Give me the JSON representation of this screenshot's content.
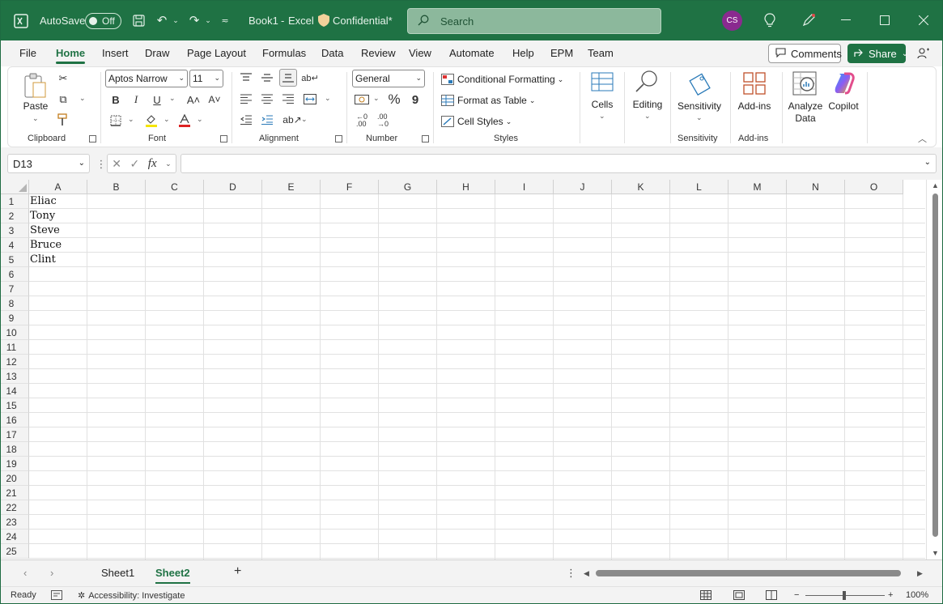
{
  "titlebar": {
    "autosave_label": "AutoSave",
    "autosave_state": "Off",
    "doc_name": "Book1",
    "app_name": "Excel",
    "separator": "-",
    "sensitivity": "Confidential*",
    "search_placeholder": "Search",
    "avatar_initials": "CS"
  },
  "menu": {
    "tabs": [
      "File",
      "Home",
      "Insert",
      "Draw",
      "Page Layout",
      "Formulas",
      "Data",
      "Review",
      "View",
      "Automate",
      "Help",
      "EPM",
      "Team"
    ],
    "active": "Home",
    "comments": "Comments",
    "share": "Share"
  },
  "ribbon": {
    "clipboard": {
      "label": "Clipboard",
      "paste": "Paste"
    },
    "font": {
      "label": "Font",
      "family": "Aptos Narrow",
      "size": "11",
      "bold": "B",
      "italic": "I",
      "underline": "U",
      "grow": "A˄",
      "shrink": "A˅"
    },
    "alignment": {
      "label": "Alignment"
    },
    "number": {
      "label": "Number",
      "format": "General",
      "percent": "%",
      "comma": "9"
    },
    "styles": {
      "label": "Styles",
      "conditional": "Conditional Formatting",
      "format_table": "Format as Table",
      "cell_styles": "Cell Styles"
    },
    "cells": {
      "label": "Cells"
    },
    "editing": {
      "label": "Editing"
    },
    "sensitivity": {
      "button": "Sensitivity",
      "label": "Sensitivity"
    },
    "addins": {
      "button": "Add-ins",
      "label": "Add-ins"
    },
    "analyze": {
      "line1": "Analyze",
      "line2": "Data"
    },
    "copilot": "Copilot"
  },
  "formula_bar": {
    "name_box": "D13",
    "fx": "fx",
    "value": ""
  },
  "columns": [
    "A",
    "B",
    "C",
    "D",
    "E",
    "F",
    "G",
    "H",
    "I",
    "J",
    "K",
    "L",
    "M",
    "N",
    "O"
  ],
  "rows": [
    "1",
    "2",
    "3",
    "4",
    "5",
    "6",
    "7",
    "8",
    "9",
    "10",
    "11",
    "12",
    "13",
    "14",
    "15",
    "16",
    "17",
    "18",
    "19",
    "20",
    "21",
    "22",
    "23",
    "24",
    "25"
  ],
  "cells_A": [
    "Eliac",
    "Tony",
    "Steve",
    "Bruce",
    "Clint"
  ],
  "sheets": {
    "tabs": [
      "Sheet1",
      "Sheet2"
    ],
    "active": "Sheet2",
    "add": "+"
  },
  "status": {
    "ready": "Ready",
    "accessibility": "Accessibility: Investigate",
    "zoom": "100%"
  },
  "colors": {
    "brand": "#1f7244",
    "avatar": "#8a2a8f"
  }
}
